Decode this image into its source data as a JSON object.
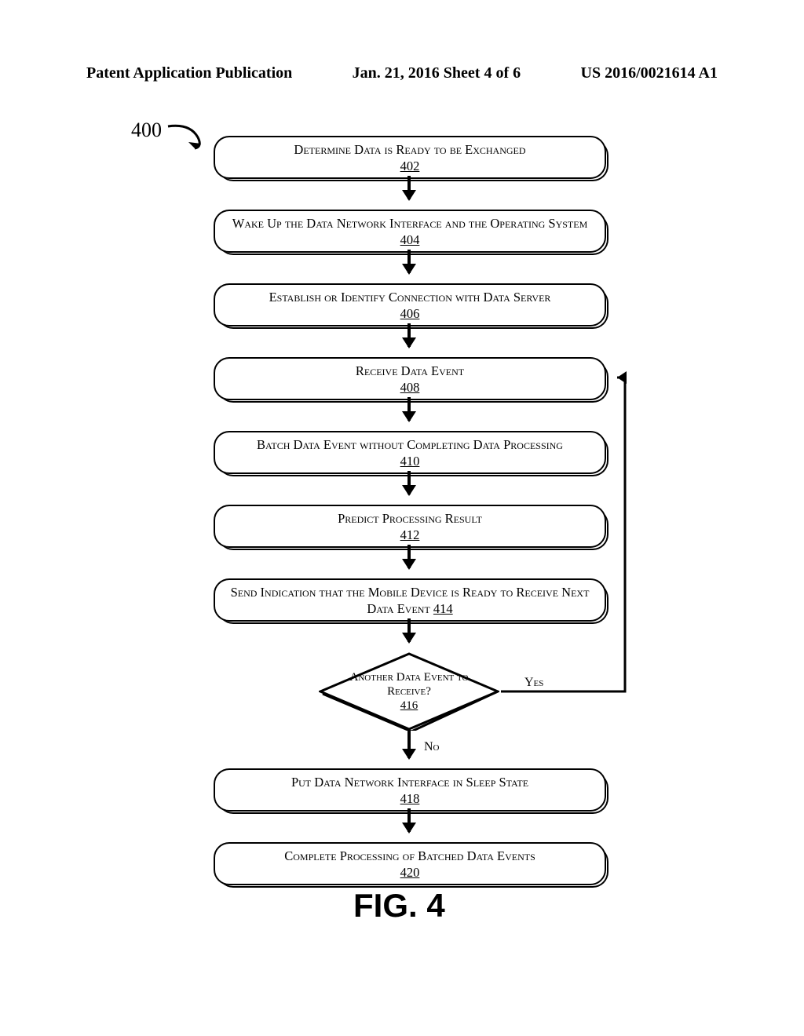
{
  "header": {
    "left": "Patent Application Publication",
    "center": "Jan. 21, 2016  Sheet 4 of 6",
    "right": "US 2016/0021614 A1"
  },
  "ref_marker": "400",
  "steps": {
    "s402": {
      "text": "Determine Data is Ready to be Exchanged",
      "ref": "402"
    },
    "s404": {
      "text": "Wake Up the Data Network Interface and the Operating System",
      "ref": "404"
    },
    "s406": {
      "text": "Establish or Identify Connection with Data Server",
      "ref": "406"
    },
    "s408": {
      "text": "Receive Data Event",
      "ref": "408"
    },
    "s410": {
      "text": "Batch Data Event without Completing Data Processing",
      "ref": "410"
    },
    "s412": {
      "text": "Predict Processing Result",
      "ref": "412"
    },
    "s414": {
      "text": "Send Indication that the Mobile Device is Ready to Receive Next Data Event",
      "ref": "414"
    },
    "s416": {
      "text": "Another Data Event to Receive?",
      "ref": "416"
    },
    "s418": {
      "text": "Put Data Network Interface in Sleep State",
      "ref": "418"
    },
    "s420": {
      "text": "Complete Processing of Batched Data Events",
      "ref": "420"
    }
  },
  "edges": {
    "yes": "Yes",
    "no": "No"
  },
  "caption": "FIG. 4"
}
